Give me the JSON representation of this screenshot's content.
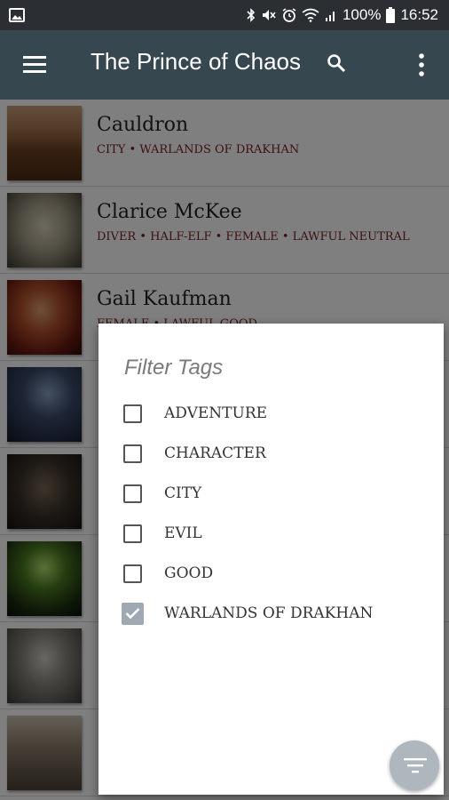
{
  "status_bar": {
    "battery": "100%",
    "time": "16:52"
  },
  "app_bar": {
    "title": "The Prince of Chaos"
  },
  "entries": [
    {
      "title": "Cauldron",
      "tags": "CITY • WARLANDS OF DRAKHAN"
    },
    {
      "title": "Clarice McKee",
      "tags": "DIVER • HALF-ELF • FEMALE • LAWFUL NEUTRAL"
    },
    {
      "title": "Gail Kaufman",
      "tags": "FEMALE • LAWFUL GOOD"
    }
  ],
  "filter_dialog": {
    "title": "Filter Tags",
    "options": [
      {
        "label": "ADVENTURE",
        "checked": false
      },
      {
        "label": "CHARACTER",
        "checked": false
      },
      {
        "label": "CITY",
        "checked": false
      },
      {
        "label": "EVIL",
        "checked": false
      },
      {
        "label": "GOOD",
        "checked": false
      },
      {
        "label": "WARLANDS OF DRAKHAN",
        "checked": true
      }
    ]
  },
  "colors": {
    "app_bar": "#37474f",
    "status_bar": "#2b2f33",
    "tag_text": "#7a1f22",
    "checked_box": "#9fa8b3",
    "fab": "#aeb6be"
  },
  "icons": {
    "menu": "hamburger-menu-icon",
    "search": "search-icon",
    "more": "more-vert-icon",
    "fab": "filter-list-icon"
  }
}
